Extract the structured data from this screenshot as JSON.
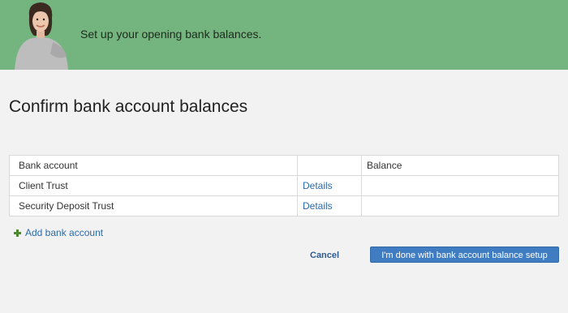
{
  "banner": {
    "message": "Set up your opening bank balances."
  },
  "page": {
    "title": "Confirm bank account balances"
  },
  "table": {
    "headers": [
      "Bank account",
      "",
      "Balance"
    ],
    "rows": [
      {
        "account": "Client Trust",
        "details": "Details",
        "balance": ""
      },
      {
        "account": "Security Deposit Trust",
        "details": "Details",
        "balance": ""
      }
    ]
  },
  "actions": {
    "add_account": "Add bank account",
    "cancel": "Cancel",
    "done": "I'm done with bank account balance setup"
  },
  "colors": {
    "banner": "#74b47f",
    "link": "#2d6aa8",
    "primary_button": "#3f7cc1",
    "add_icon": "#4d8a2e"
  },
  "icons": {
    "add": "plus-icon",
    "person": "avatar"
  }
}
